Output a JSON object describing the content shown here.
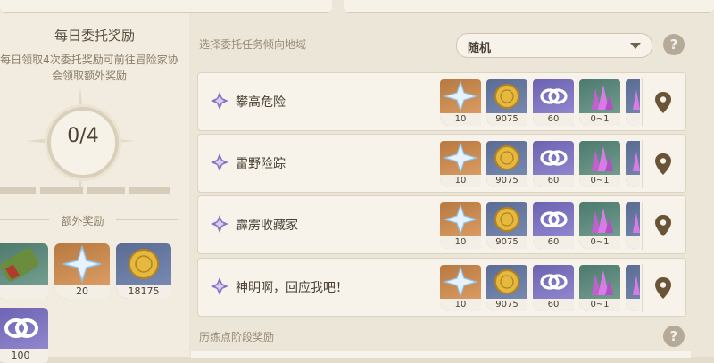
{
  "left_panel": {
    "title": "每日委托奖励",
    "description": "每日领取4次委托奖励可前往冒险家协会领取额外奖励",
    "counter": "0/4",
    "progress_completed": 0,
    "progress_total": 4,
    "extra_rewards_title": "额外奖励",
    "extra_rewards": [
      {
        "icon": "scroll-icon",
        "qty": ""
      },
      {
        "icon": "primogem-icon",
        "qty": "20"
      },
      {
        "icon": "mora-coin-icon",
        "qty": "18175"
      },
      {
        "icon": "companionship-exp-icon",
        "qty": "100"
      }
    ]
  },
  "region_filter": {
    "label": "选择委托任务倾向地域",
    "selected": "随机",
    "help": "?"
  },
  "commissions": [
    {
      "name": "攀高危险",
      "rewards": [
        "10",
        "9075",
        "60",
        "0~1"
      ]
    },
    {
      "name": "雷野险踪",
      "rewards": [
        "10",
        "9075",
        "60",
        "0~1"
      ]
    },
    {
      "name": "霹雳收藏家",
      "rewards": [
        "10",
        "9075",
        "60",
        "0~1"
      ]
    },
    {
      "name": "神明啊，回应我吧！",
      "rewards": [
        "10",
        "9075",
        "60",
        "0~1"
      ]
    }
  ],
  "reward_icons": [
    "primogem-icon",
    "mora-coin-icon",
    "companionship-exp-icon",
    "crystal-icon",
    "crystal-icon"
  ],
  "stage_rewards": {
    "label": "历练点阶段奖励",
    "help": "?"
  },
  "colors": {
    "orange": "#c98a4e",
    "blue": "#6b7ca3",
    "purple": "#7d73c2",
    "green": "#5f8d80",
    "text": "#4a4034"
  }
}
